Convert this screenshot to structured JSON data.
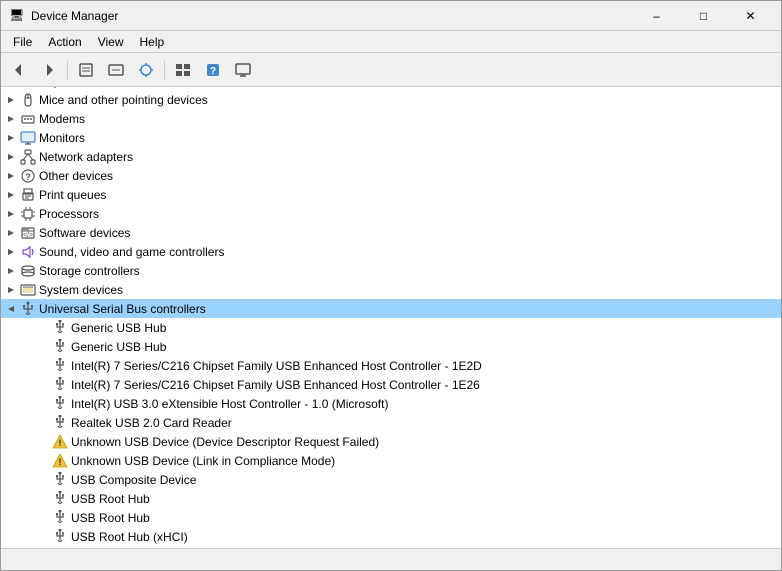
{
  "window": {
    "title": "Device Manager",
    "icon": "🖥",
    "controls": {
      "minimize": "–",
      "maximize": "□",
      "close": "✕"
    }
  },
  "menubar": {
    "items": [
      "File",
      "Action",
      "View",
      "Help"
    ]
  },
  "toolbar": {
    "buttons": [
      "←",
      "→",
      "📋",
      "📄",
      "⚡",
      "📦",
      "🖥"
    ]
  },
  "tree": {
    "items": [
      {
        "id": "keyboards",
        "label": "Keyboards",
        "indent": 1,
        "expanded": false,
        "selected": false,
        "hasChevron": true,
        "iconType": "keyboard"
      },
      {
        "id": "mice",
        "label": "Mice and other pointing devices",
        "indent": 1,
        "expanded": false,
        "selected": false,
        "hasChevron": true,
        "iconType": "mouse"
      },
      {
        "id": "modems",
        "label": "Modems",
        "indent": 1,
        "expanded": false,
        "selected": false,
        "hasChevron": true,
        "iconType": "modem"
      },
      {
        "id": "monitors",
        "label": "Monitors",
        "indent": 1,
        "expanded": false,
        "selected": false,
        "hasChevron": true,
        "iconType": "monitor"
      },
      {
        "id": "network",
        "label": "Network adapters",
        "indent": 1,
        "expanded": false,
        "selected": false,
        "hasChevron": true,
        "iconType": "network"
      },
      {
        "id": "other",
        "label": "Other devices",
        "indent": 1,
        "expanded": false,
        "selected": false,
        "hasChevron": true,
        "iconType": "other"
      },
      {
        "id": "print",
        "label": "Print queues",
        "indent": 1,
        "expanded": false,
        "selected": false,
        "hasChevron": true,
        "iconType": "print"
      },
      {
        "id": "processors",
        "label": "Processors",
        "indent": 1,
        "expanded": false,
        "selected": false,
        "hasChevron": true,
        "iconType": "chip"
      },
      {
        "id": "software",
        "label": "Software devices",
        "indent": 1,
        "expanded": false,
        "selected": false,
        "hasChevron": true,
        "iconType": "software"
      },
      {
        "id": "sound",
        "label": "Sound, video and game controllers",
        "indent": 1,
        "expanded": false,
        "selected": false,
        "hasChevron": true,
        "iconType": "sound"
      },
      {
        "id": "storage",
        "label": "Storage controllers",
        "indent": 1,
        "expanded": false,
        "selected": false,
        "hasChevron": true,
        "iconType": "storage"
      },
      {
        "id": "system",
        "label": "System devices",
        "indent": 1,
        "expanded": false,
        "selected": false,
        "hasChevron": true,
        "iconType": "system"
      },
      {
        "id": "usb",
        "label": "Universal Serial Bus controllers",
        "indent": 1,
        "expanded": true,
        "selected": true,
        "hasChevron": true,
        "iconType": "usb"
      },
      {
        "id": "usb-hub1",
        "label": "Generic USB Hub",
        "indent": 2,
        "expanded": false,
        "selected": false,
        "hasChevron": false,
        "iconType": "usb-dev"
      },
      {
        "id": "usb-hub2",
        "label": "Generic USB Hub",
        "indent": 2,
        "expanded": false,
        "selected": false,
        "hasChevron": false,
        "iconType": "usb-dev"
      },
      {
        "id": "intel-1e2d",
        "label": "Intel(R) 7 Series/C216 Chipset Family USB Enhanced Host Controller - 1E2D",
        "indent": 2,
        "expanded": false,
        "selected": false,
        "hasChevron": false,
        "iconType": "usb-dev"
      },
      {
        "id": "intel-1e26",
        "label": "Intel(R) 7 Series/C216 Chipset Family USB Enhanced Host Controller - 1E26",
        "indent": 2,
        "expanded": false,
        "selected": false,
        "hasChevron": false,
        "iconType": "usb-dev"
      },
      {
        "id": "intel-usb3",
        "label": "Intel(R) USB 3.0 eXtensible Host Controller - 1.0 (Microsoft)",
        "indent": 2,
        "expanded": false,
        "selected": false,
        "hasChevron": false,
        "iconType": "usb-dev"
      },
      {
        "id": "realtek",
        "label": "Realtek USB 2.0 Card Reader",
        "indent": 2,
        "expanded": false,
        "selected": false,
        "hasChevron": false,
        "iconType": "usb-dev"
      },
      {
        "id": "unknown1",
        "label": "Unknown USB Device (Device Descriptor Request Failed)",
        "indent": 2,
        "expanded": false,
        "selected": false,
        "hasChevron": false,
        "iconType": "warning"
      },
      {
        "id": "unknown2",
        "label": "Unknown USB Device (Link in Compliance Mode)",
        "indent": 2,
        "expanded": false,
        "selected": false,
        "hasChevron": false,
        "iconType": "warning"
      },
      {
        "id": "composite",
        "label": "USB Composite Device",
        "indent": 2,
        "expanded": false,
        "selected": false,
        "hasChevron": false,
        "iconType": "usb-dev"
      },
      {
        "id": "root-hub1",
        "label": "USB Root Hub",
        "indent": 2,
        "expanded": false,
        "selected": false,
        "hasChevron": false,
        "iconType": "usb-dev"
      },
      {
        "id": "root-hub2",
        "label": "USB Root Hub",
        "indent": 2,
        "expanded": false,
        "selected": false,
        "hasChevron": false,
        "iconType": "usb-dev"
      },
      {
        "id": "root-hub-xhci",
        "label": "USB Root Hub (xHCI)",
        "indent": 2,
        "expanded": false,
        "selected": false,
        "hasChevron": false,
        "iconType": "usb-dev"
      }
    ]
  },
  "statusbar": {
    "text": ""
  }
}
